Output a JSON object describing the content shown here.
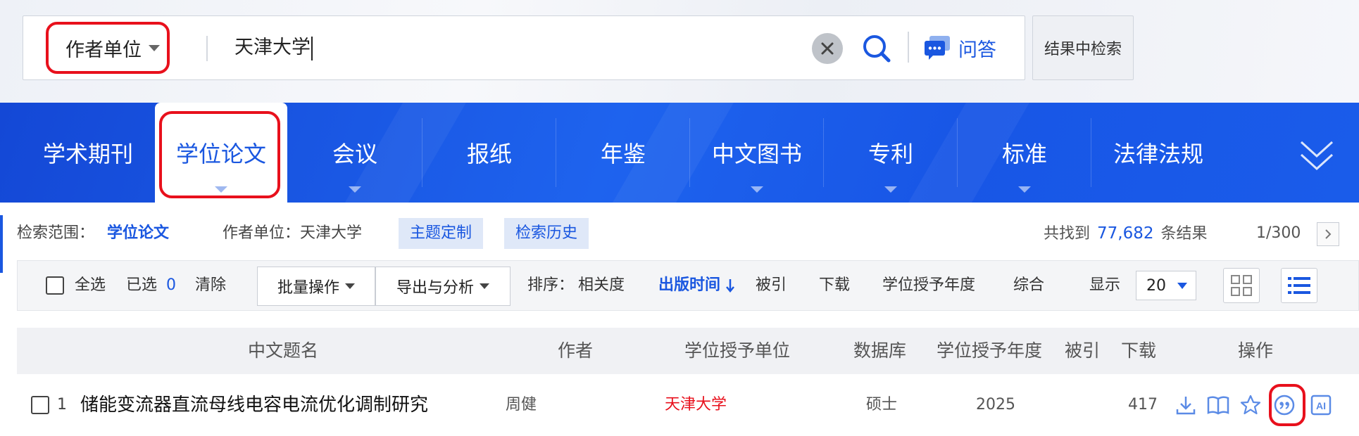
{
  "search": {
    "field": "作者单位",
    "query": "天津大学",
    "ask_label": "问答",
    "within_label": "结果中检索"
  },
  "tabs": [
    {
      "label": "学术期刊"
    },
    {
      "label": "学位论文",
      "active": true
    },
    {
      "label": "会议"
    },
    {
      "label": "报纸"
    },
    {
      "label": "年鉴"
    },
    {
      "label": "中文图书"
    },
    {
      "label": "专利"
    },
    {
      "label": "标准"
    },
    {
      "label": "法律法规"
    }
  ],
  "scope": {
    "label": "检索范围：",
    "value": "学位论文",
    "author_unit": "作者单位：天津大学",
    "topic_btn": "主题定制",
    "history_btn": "检索历史",
    "found_prefix": "共找到",
    "found_count": "77,682",
    "found_suffix": "条结果",
    "page": "1/300"
  },
  "toolbar": {
    "select_all": "全选",
    "selected_label": "已选",
    "selected_count": "0",
    "clear": "清除",
    "batch": "批量操作",
    "export": "导出与分析",
    "sort_label": "排序：",
    "sort_relevance": "相关度",
    "sort_pubtime": "出版时间",
    "sort_cited": "被引",
    "sort_download": "下载",
    "sort_degree_year": "学位授予年度",
    "sort_overall": "综合",
    "show_label": "显示",
    "page_size": "20"
  },
  "table": {
    "headers": {
      "title": "中文题名",
      "author": "作者",
      "unit": "学位授予单位",
      "db": "数据库",
      "year": "学位授予年度",
      "cited": "被引",
      "download": "下载",
      "ops": "操作"
    },
    "rows": [
      {
        "index": "1",
        "title": "储能变流器直流母线电容电流优化调制研究",
        "author": "周健",
        "unit": "天津大学",
        "db": "硕士",
        "year": "2025",
        "cited": "",
        "download": "417"
      }
    ],
    "op_icons": [
      "download-icon",
      "read-icon",
      "favorite-icon",
      "cite-icon",
      "ai-icon"
    ],
    "ai_label": "AI"
  },
  "colors": {
    "accent": "#1a57e0",
    "highlight": "#e8101c",
    "tabbar": "#1e5fec"
  }
}
